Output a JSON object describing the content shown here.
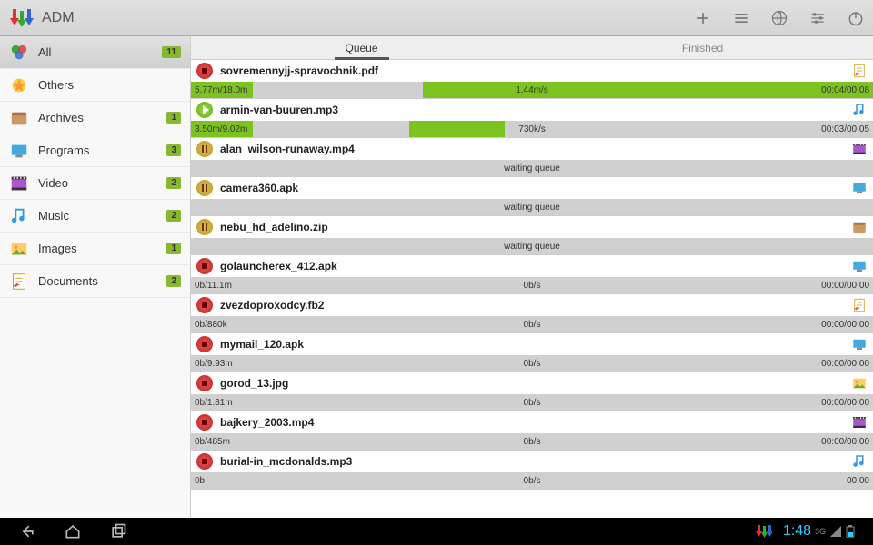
{
  "app_title": "ADM",
  "toolbar": {
    "add": "+",
    "list": "≡",
    "globe": "🌐",
    "settings": "⚙",
    "power": "⏻"
  },
  "sidebar": {
    "items": [
      {
        "label": "All",
        "count": "11",
        "selected": true,
        "icon": "all"
      },
      {
        "label": "Others",
        "count": "",
        "icon": "others"
      },
      {
        "label": "Archives",
        "count": "1",
        "icon": "archive"
      },
      {
        "label": "Programs",
        "count": "3",
        "icon": "program"
      },
      {
        "label": "Video",
        "count": "2",
        "icon": "video"
      },
      {
        "label": "Music",
        "count": "2",
        "icon": "music"
      },
      {
        "label": "Images",
        "count": "1",
        "icon": "image"
      },
      {
        "label": "Documents",
        "count": "2",
        "icon": "document"
      }
    ]
  },
  "tabs": {
    "queue": "Queue",
    "finished": "Finished"
  },
  "downloads": [
    {
      "state": "stopped",
      "name": "sovremennyjj-spravochnik.pdf",
      "type": "document",
      "size": "5.77m/18.0m",
      "speed": "1.44m/s",
      "time": "00:04/00:08",
      "segments": [
        9,
        12,
        0,
        13,
        19,
        0,
        7,
        0,
        20,
        0,
        20,
        0,
        0
      ]
    },
    {
      "state": "playing",
      "name": "armin-van-buuren.mp3",
      "type": "music",
      "size": "3.50m/9.02m",
      "speed": "730k/s",
      "time": "00:03/00:05",
      "segments": [
        9,
        12,
        0,
        11,
        8,
        0,
        6,
        7,
        0,
        18,
        0,
        24,
        0,
        5
      ]
    },
    {
      "state": "paused",
      "name": "alan_wilson-runaway.mp4",
      "type": "video",
      "size": "",
      "speed": "waiting queue",
      "time": "",
      "segments": []
    },
    {
      "state": "paused",
      "name": "camera360.apk",
      "type": "program",
      "size": "",
      "speed": "waiting queue",
      "time": "",
      "segments": []
    },
    {
      "state": "paused",
      "name": "nebu_hd_adelino.zip",
      "type": "archive",
      "size": "",
      "speed": "waiting queue",
      "time": "",
      "segments": []
    },
    {
      "state": "stopped",
      "name": "golauncherex_412.apk",
      "type": "program",
      "size": "0b/11.1m",
      "speed": "0b/s",
      "time": "00:00/00:00",
      "segments": []
    },
    {
      "state": "stopped",
      "name": "zvezdoproxodcy.fb2",
      "type": "document",
      "size": "0b/880k",
      "speed": "0b/s",
      "time": "00:00/00:00",
      "segments": []
    },
    {
      "state": "stopped",
      "name": "mymail_120.apk",
      "type": "program",
      "size": "0b/9.93m",
      "speed": "0b/s",
      "time": "00:00/00:00",
      "segments": []
    },
    {
      "state": "stopped",
      "name": "gorod_13.jpg",
      "type": "image",
      "size": "0b/1.81m",
      "speed": "0b/s",
      "time": "00:00/00:00",
      "segments": []
    },
    {
      "state": "stopped",
      "name": "bajkery_2003.mp4",
      "type": "video",
      "size": "0b/485m",
      "speed": "0b/s",
      "time": "00:00/00:00",
      "segments": []
    },
    {
      "state": "stopped",
      "name": "burial-in_mcdonalds.mp3",
      "type": "music",
      "size": "0b",
      "speed": "0b/s",
      "time": "00:00",
      "segments": []
    }
  ],
  "statusbar": {
    "time": "1:48",
    "network": "3G"
  }
}
